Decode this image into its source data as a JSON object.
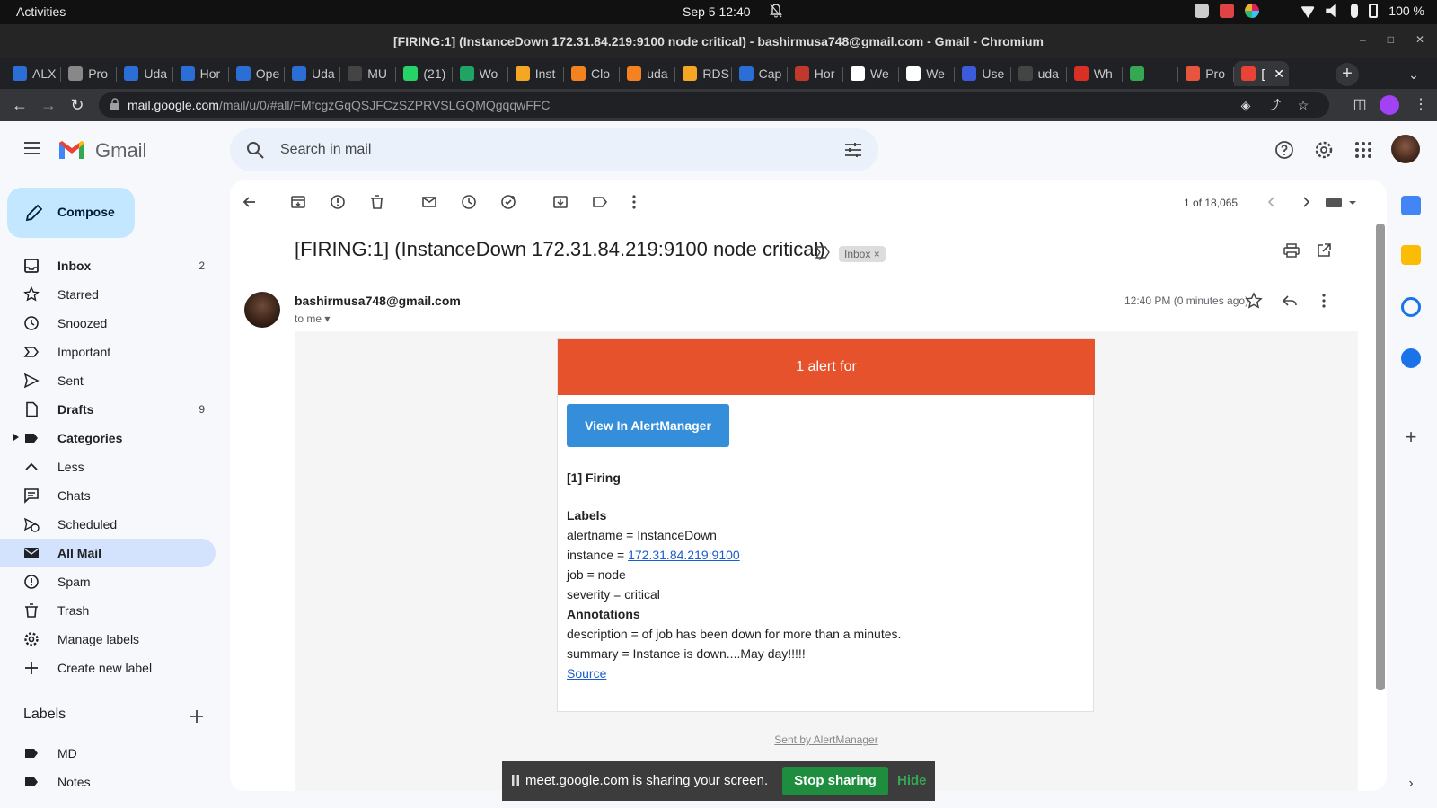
{
  "os": {
    "activities": "Activities",
    "clock": "Sep 5  12:40",
    "battery_pct": "100 %"
  },
  "window": {
    "title": "[FIRING:1] (InstanceDown 172.31.84.219:9100 node critical) - bashirmusa748@gmail.com - Gmail - Chromium"
  },
  "tabs": [
    {
      "label": "ALX",
      "color": "#2b6fd6"
    },
    {
      "label": "Pro",
      "color": "#888888"
    },
    {
      "label": "Uda",
      "color": "#2b6fd6"
    },
    {
      "label": "Hor",
      "color": "#2b6fd6"
    },
    {
      "label": "Ope",
      "color": "#2b6fd6"
    },
    {
      "label": "Uda",
      "color": "#2b6fd6"
    },
    {
      "label": "MU",
      "color": "#444444"
    },
    {
      "label": "(21)",
      "color": "#25d366"
    },
    {
      "label": "Wo",
      "color": "#1fa463"
    },
    {
      "label": "Inst",
      "color": "#f5a623"
    },
    {
      "label": "Clo",
      "color": "#f58220"
    },
    {
      "label": "uda",
      "color": "#f58220"
    },
    {
      "label": "RDS",
      "color": "#f5a623"
    },
    {
      "label": "Cap",
      "color": "#2b6fd6"
    },
    {
      "label": "Hor",
      "color": "#c0392b"
    },
    {
      "label": "We",
      "color": "#ffffff"
    },
    {
      "label": "We",
      "color": "#ffffff"
    },
    {
      "label": "Use",
      "color": "#3b5bdb"
    },
    {
      "label": "uda",
      "color": "#444444"
    },
    {
      "label": "Wh",
      "color": "#d93025"
    },
    {
      "label": "",
      "color": "#34a853"
    },
    {
      "label": "Pro",
      "color": "#e8553d"
    },
    {
      "label": "[",
      "color": "#ea4335"
    }
  ],
  "address": {
    "host": "mail.google.com",
    "path": "/mail/u/0/#all/FMfcgzGqQSJFCzSZPRVSLGQMQgqqwFFC"
  },
  "gmail": {
    "logo_text": "Gmail",
    "search_placeholder": "Search in mail",
    "compose_label": "Compose",
    "nav": [
      {
        "label": "Inbox",
        "count": "2",
        "icon": "inbox-icon",
        "bold": true
      },
      {
        "label": "Starred",
        "count": "",
        "icon": "star-icon"
      },
      {
        "label": "Snoozed",
        "count": "",
        "icon": "clock-icon"
      },
      {
        "label": "Important",
        "count": "",
        "icon": "important-icon"
      },
      {
        "label": "Sent",
        "count": "",
        "icon": "send-icon"
      },
      {
        "label": "Drafts",
        "count": "9",
        "icon": "draft-icon",
        "bold": true
      },
      {
        "label": "Categories",
        "count": "",
        "icon": "label-icon",
        "bold": true
      },
      {
        "label": "Less",
        "count": "",
        "icon": "chevron-up-icon"
      },
      {
        "label": "Chats",
        "count": "",
        "icon": "chat-icon"
      },
      {
        "label": "Scheduled",
        "count": "",
        "icon": "scheduled-icon"
      },
      {
        "label": "All Mail",
        "count": "",
        "icon": "all-mail-icon",
        "active": true
      },
      {
        "label": "Spam",
        "count": "",
        "icon": "spam-icon"
      },
      {
        "label": "Trash",
        "count": "",
        "icon": "trash-icon"
      },
      {
        "label": "Manage labels",
        "count": "",
        "icon": "gear-icon"
      },
      {
        "label": "Create new label",
        "count": "",
        "icon": "plus-icon"
      }
    ],
    "labels_header": "Labels",
    "labels": [
      "MD",
      "Notes"
    ]
  },
  "message": {
    "pager": "1 of 18,065",
    "subject": "[FIRING:1] (InstanceDown 172.31.84.219:9100 node critical)",
    "inbox_chip": "Inbox",
    "sender": "bashirmusa748@gmail.com",
    "to_me": "to me",
    "time": "12:40 PM (0 minutes ago)"
  },
  "alert": {
    "header": "1 alert for",
    "button": "View In AlertManager",
    "firing": "[1] Firing",
    "labels_title": "Labels",
    "alertname": "alertname = InstanceDown",
    "instance_prefix": "instance = ",
    "instance_link": "172.31.84.219:9100",
    "job": "job = node",
    "severity": "severity = critical",
    "annotations_title": "Annotations",
    "description": "description = of job has been down for more than a minutes.",
    "summary": "summary = Instance is down....May day!!!!!",
    "source_link": "Source",
    "sent_by": "Sent by AlertManager",
    "header_color": "#e6522c",
    "button_color": "#348eda"
  },
  "share": {
    "text": "meet.google.com is sharing your screen.",
    "stop": "Stop sharing",
    "hide": "Hide"
  }
}
